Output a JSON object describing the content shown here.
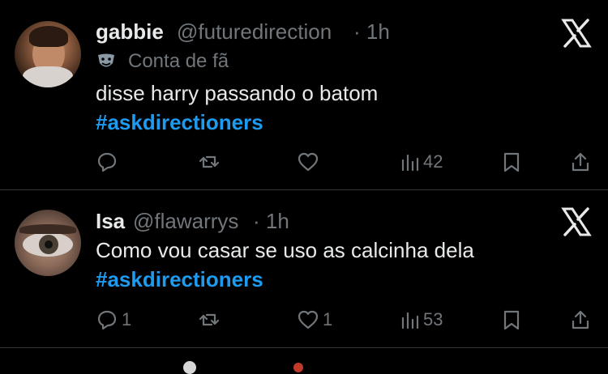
{
  "tweets": [
    {
      "display_name": "gabbie",
      "handle": "@futuredirection",
      "time": "· 1h",
      "badge_icon": "theater-masks-icon",
      "badge_label": "Conta de fã",
      "text": "disse harry passando o batom",
      "hashtag": "#askdirectioners",
      "reply_count": "",
      "retweet_count": "",
      "like_count": "",
      "view_count": "42"
    },
    {
      "display_name": "Isa",
      "handle": "@flawarrys",
      "time": "· 1h",
      "text": "Como vou casar se uso as calcinha dela",
      "hashtag": "#askdirectioners",
      "reply_count": "1",
      "retweet_count": "",
      "like_count": "1",
      "view_count": "53"
    }
  ],
  "colors": {
    "background": "#000000",
    "text": "#e7e9ea",
    "muted": "#71767b",
    "hashtag": "#1d9bf0",
    "divider": "#2f3336"
  }
}
